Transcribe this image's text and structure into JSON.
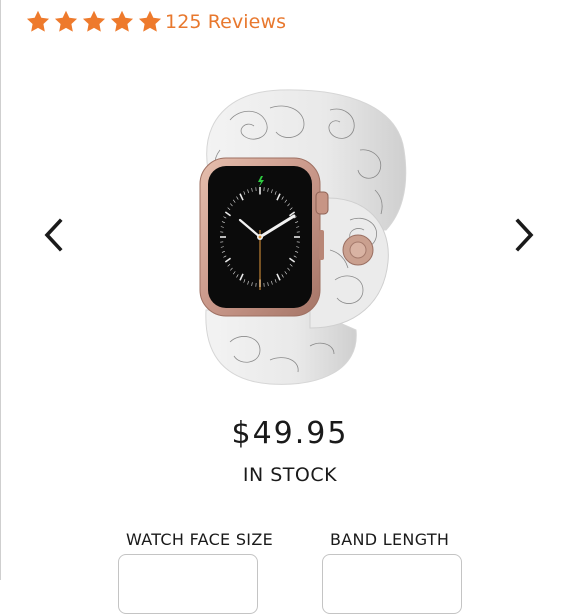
{
  "rating": {
    "stars": 5,
    "reviews_text": "125 Reviews",
    "star_color": "#ee7a2c",
    "reviews_color": "#e8782e"
  },
  "carousel": {
    "prev_icon": "chevron-left-icon",
    "next_icon": "chevron-right-icon",
    "image_alt": "Apple Watch with white floral rose-print silicone band and rose gold case"
  },
  "product": {
    "price": "$49.95",
    "stock_status": "IN STOCK"
  },
  "options": {
    "watch_face_size_label": "WATCH FACE SIZE",
    "band_length_label": "BAND LENGTH"
  }
}
